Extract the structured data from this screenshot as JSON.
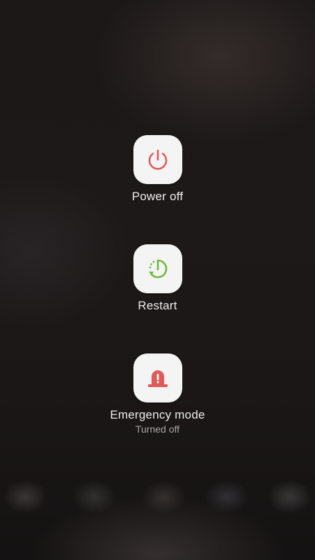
{
  "power_menu": {
    "options": [
      {
        "label": "Power off",
        "icon": "power-icon",
        "color": "#e05a5a"
      },
      {
        "label": "Restart",
        "icon": "restart-icon",
        "color": "#6fba3c"
      },
      {
        "label": "Emergency mode",
        "sublabel": "Turned off",
        "icon": "siren-icon",
        "color": "#e05a5a"
      }
    ]
  }
}
